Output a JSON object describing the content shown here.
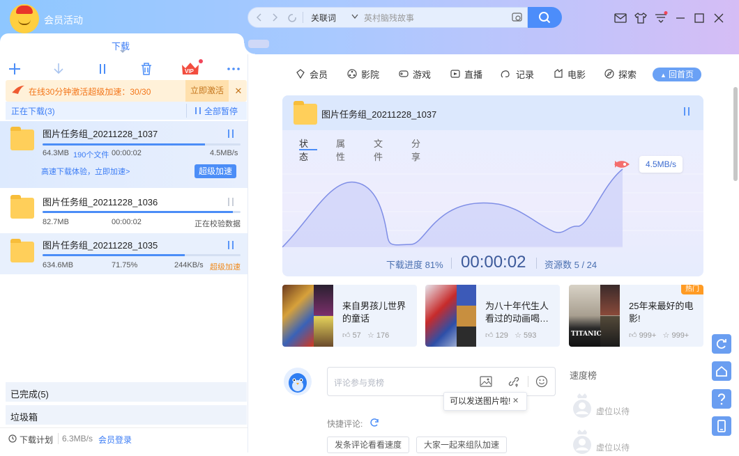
{
  "window": {
    "title": "会员活动"
  },
  "search": {
    "scope": "关联词",
    "placeholder": "英村脑残故事"
  },
  "left": {
    "tab": "下载",
    "promo": {
      "text": "在线30分钟激活超级加速：30/30",
      "button": "立即激活",
      "close": "✕"
    },
    "downloading": {
      "label": "正在下载(3)",
      "pause_all": "全部暂停"
    },
    "tasks": [
      {
        "name": "图片任务组_20211228_1037",
        "size": "64.3MB",
        "files": "190个文件",
        "time": "00:00:02",
        "speed": "4.5MB/s",
        "progress": 0.82,
        "link": "高速下载体验，立即加速>",
        "button": "超级加速"
      },
      {
        "name": "图片任务组_20211228_1036",
        "size": "82.7MB",
        "time": "00:00:02",
        "status": "正在校验数据",
        "progress": 0.96
      },
      {
        "name": "图片任务组_20211228_1035",
        "size": "634.6MB",
        "percent": "71.75%",
        "speed": "244KB/s",
        "boost": "超级加速",
        "progress": 0.7175
      }
    ],
    "completed": "已完成(5)",
    "trash": "垃圾箱",
    "status": {
      "plan": "下载计划",
      "speed": "6.3MB/s",
      "login": "会员登录"
    }
  },
  "nav": {
    "items": [
      "会员",
      "影院",
      "游戏",
      "直播",
      "记录",
      "电影",
      "探索"
    ],
    "home": "回首页"
  },
  "card": {
    "title": "图片任务组_20211228_1037",
    "tabs": [
      "状态",
      "属性",
      "文件",
      "分享"
    ],
    "speed": "4.5MB/s",
    "progress": "下载进度 81%",
    "time": "00:00:02",
    "resources": "资源数 5 / 24"
  },
  "videos": [
    {
      "title": "来自男孩儿世界的童话",
      "likes": "57",
      "stars": "176"
    },
    {
      "title": "为八十年代生人看过的动画喝…",
      "likes": "129",
      "stars": "593"
    },
    {
      "title": "25年来最好的电影!",
      "likes": "999+",
      "stars": "999+",
      "badge": "热门"
    }
  ],
  "comment": {
    "placeholder": "评论参与竞榜",
    "tooltip": "可以发送图片啦!",
    "tooltip_close": "✕",
    "quick_label": "快捷评论:",
    "quick": [
      "发条评论看看速度",
      "大家一起来组队加速"
    ]
  },
  "rank": {
    "title": "速度榜",
    "items": [
      "虚位以待",
      "虚位以待"
    ]
  },
  "colors": {
    "accent": "#4b8df7",
    "promo": "#f3761a",
    "chart_fill": "#d3d6fa"
  }
}
